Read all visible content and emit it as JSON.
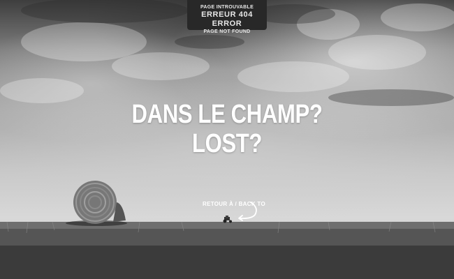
{
  "error_banner": {
    "line1": "PAGE INTROUVABLE",
    "line2": "ERREUR  404  ERROR",
    "line3": "PAGE NOT FOUND"
  },
  "headline": {
    "line1": "DANS LE CHAMP?",
    "line2": "LOST?"
  },
  "back_link": {
    "label": "RETOUR À / BACK TO"
  },
  "colors": {
    "banner_bg": "#282828",
    "text": "#ffffff"
  }
}
